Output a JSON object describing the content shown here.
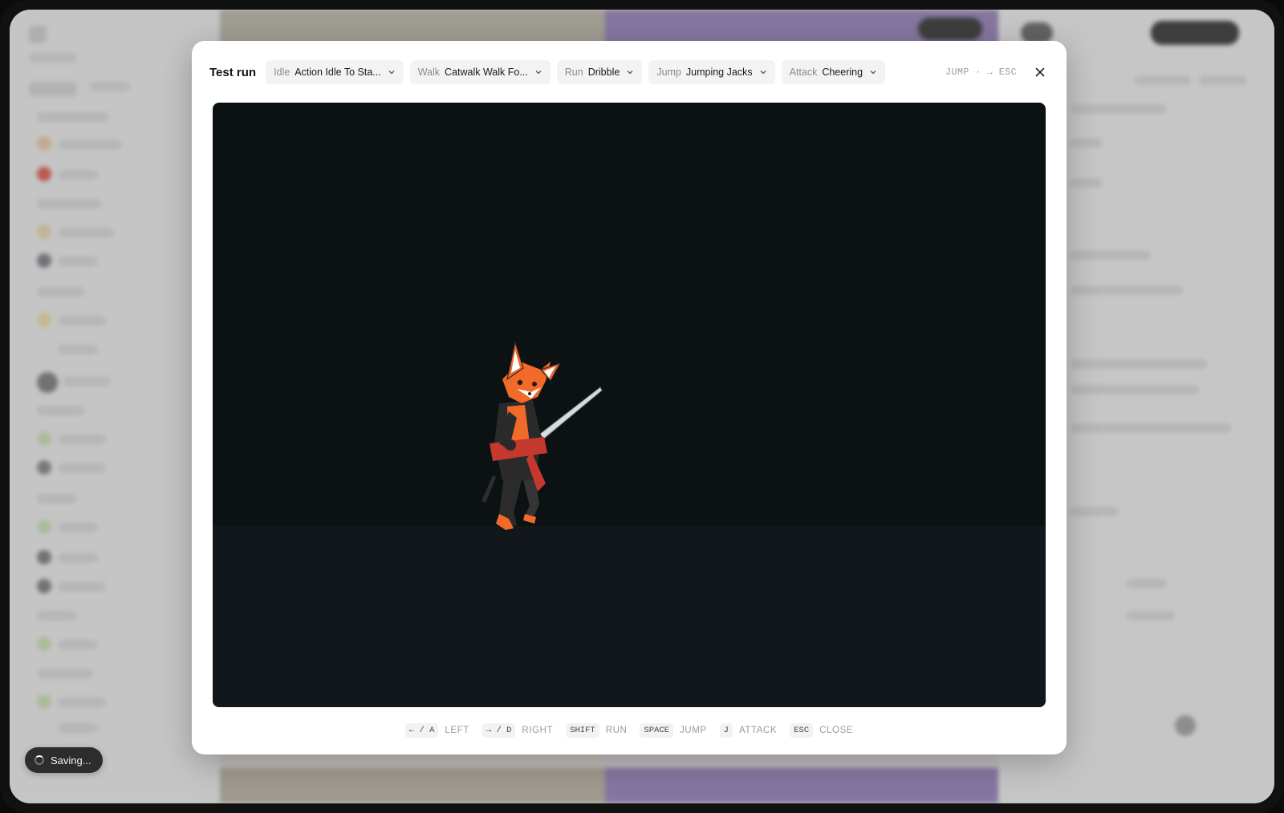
{
  "modal": {
    "title": "Test run",
    "animations": [
      {
        "label": "Idle",
        "value": "Action Idle To Sta..."
      },
      {
        "label": "Walk",
        "value": "Catwalk Walk Fo..."
      },
      {
        "label": "Run",
        "value": "Dribble"
      },
      {
        "label": "Jump",
        "value": "Jumping Jacks"
      },
      {
        "label": "Attack",
        "value": "Cheering"
      }
    ],
    "state_hint": "JUMP · → ESC",
    "close_icon": "close-icon"
  },
  "controls": [
    {
      "keys": "← / A",
      "action": "LEFT"
    },
    {
      "keys": "→ / D",
      "action": "RIGHT"
    },
    {
      "keys": "SHIFT",
      "action": "RUN"
    },
    {
      "keys": "SPACE",
      "action": "JUMP"
    },
    {
      "keys": "J",
      "action": "ATTACK"
    },
    {
      "keys": "ESC",
      "action": "CLOSE"
    }
  ],
  "toast": {
    "text": "Saving...",
    "icon": "spinner-icon"
  },
  "colors": {
    "canvas_bg": "#0c1114",
    "ground": "#11171a",
    "fox_orange": "#f26a2a",
    "modal_bg": "#ffffff"
  }
}
